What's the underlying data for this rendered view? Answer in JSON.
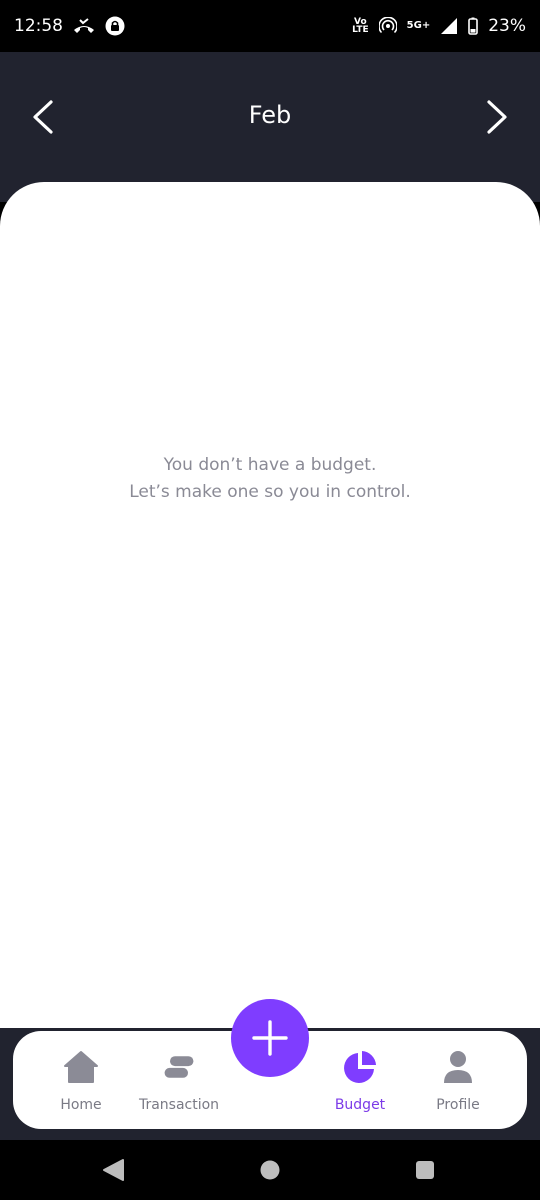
{
  "status_bar": {
    "time": "12:58",
    "volte_top": "Vo",
    "volte_bottom": "LTE",
    "network": "5G+",
    "battery": "23%"
  },
  "header": {
    "month": "Feb",
    "prev_icon": "chevron-left-icon",
    "next_icon": "chevron-right-icon"
  },
  "empty_state": {
    "line1": "You don’t have a budget.",
    "line2": "Let’s make one so you in control."
  },
  "fab": {
    "icon": "plus-icon"
  },
  "tabs": [
    {
      "label": "Home",
      "icon": "home-icon"
    },
    {
      "label": "Transaction",
      "icon": "transaction-icon"
    },
    {
      "label": "Budget",
      "icon": "pie-chart-icon"
    },
    {
      "label": "Profile",
      "icon": "user-icon"
    }
  ],
  "active_tab": "Budget",
  "colors": {
    "accent": "#7F3DFF",
    "header_bg": "#21232F",
    "inactive": "#7A7A85",
    "icon_inactive": "#8B8B96"
  }
}
